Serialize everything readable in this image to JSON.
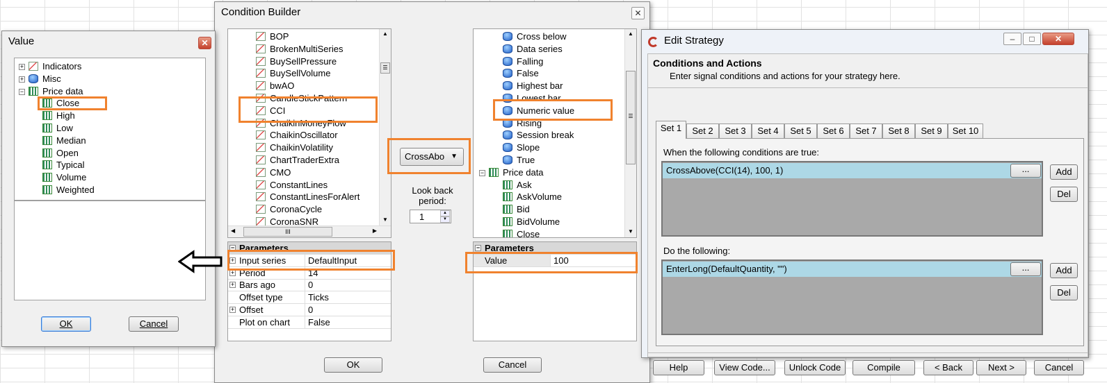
{
  "value_dialog": {
    "title": "Value",
    "tree": [
      {
        "label": "Indicators",
        "icon": "chart-icon",
        "exp": "+"
      },
      {
        "label": "Misc",
        "icon": "db-icon",
        "exp": "+"
      },
      {
        "label": "Price data",
        "icon": "bar-icon",
        "exp": "−"
      },
      {
        "label": "Close",
        "icon": "bar-icon"
      },
      {
        "label": "High",
        "icon": "bar-icon"
      },
      {
        "label": "Low",
        "icon": "bar-icon"
      },
      {
        "label": "Median",
        "icon": "bar-icon"
      },
      {
        "label": "Open",
        "icon": "bar-icon"
      },
      {
        "label": "Typical",
        "icon": "bar-icon"
      },
      {
        "label": "Volume",
        "icon": "bar-icon"
      },
      {
        "label": "Weighted",
        "icon": "bar-icon"
      }
    ],
    "ok": "OK",
    "cancel": "Cancel"
  },
  "condition_builder": {
    "title": "Condition Builder",
    "left_list": [
      "BOP",
      "BrokenMultiSeries",
      "BuySellPressure",
      "BuySellVolume",
      "bwAO",
      "CandleStickPattern",
      "CCI",
      "ChaikinMoneyFlow",
      "ChaikinOscillator",
      "ChaikinVolatility",
      "ChartTraderExtra",
      "CMO",
      "ConstantLines",
      "ConstantLinesForAlert",
      "CoronaCycle",
      "CoronaSNR"
    ],
    "hscroll_glyph": "III",
    "left_params_header": "Parameters",
    "left_params": [
      {
        "k": "Input series",
        "v": "DefaultInput",
        "exp": "+"
      },
      {
        "k": "Period",
        "v": "14",
        "exp": "+"
      },
      {
        "k": "Bars ago",
        "v": "0",
        "exp": "+"
      },
      {
        "k": "Offset type",
        "v": "Ticks",
        "exp": ""
      },
      {
        "k": "Offset",
        "v": "0",
        "exp": "+"
      },
      {
        "k": "Plot on chart",
        "v": "False",
        "exp": ""
      }
    ],
    "operator": "CrossAbo",
    "lookback_label": "Look back\nperiod:",
    "lookback_value": "1",
    "right_list": [
      {
        "label": "Cross below",
        "icon": "db-icon",
        "indent": 1
      },
      {
        "label": "Data series",
        "icon": "db-icon",
        "indent": 1
      },
      {
        "label": "Falling",
        "icon": "db-icon",
        "indent": 1
      },
      {
        "label": "False",
        "icon": "db-icon",
        "indent": 1
      },
      {
        "label": "Highest bar",
        "icon": "db-icon",
        "indent": 1
      },
      {
        "label": "Lowest bar",
        "icon": "db-icon",
        "indent": 1
      },
      {
        "label": "Numeric value",
        "icon": "db-icon",
        "indent": 1
      },
      {
        "label": "Rising",
        "icon": "db-icon",
        "indent": 1
      },
      {
        "label": "Session break",
        "icon": "db-icon",
        "indent": 1
      },
      {
        "label": "Slope",
        "icon": "db-icon",
        "indent": 1
      },
      {
        "label": "True",
        "icon": "db-icon",
        "indent": 1
      },
      {
        "label": "Price data",
        "icon": "bar-icon",
        "indent": 0,
        "exp": "−"
      },
      {
        "label": "Ask",
        "icon": "bar-icon",
        "indent": 1
      },
      {
        "label": "AskVolume",
        "icon": "bar-icon",
        "indent": 1
      },
      {
        "label": "Bid",
        "icon": "bar-icon",
        "indent": 1
      },
      {
        "label": "BidVolume",
        "icon": "bar-icon",
        "indent": 1
      },
      {
        "label": "Close",
        "icon": "bar-icon",
        "indent": 1
      }
    ],
    "right_params_header": "Parameters",
    "right_params": [
      {
        "k": "Value",
        "v": "100"
      }
    ],
    "ok": "OK",
    "cancel": "Cancel"
  },
  "edit_strategy": {
    "title": "Edit Strategy",
    "heading": "Conditions and Actions",
    "subheading": "Enter signal conditions and actions for your strategy here.",
    "tabs": [
      "Set 1",
      "Set 2",
      "Set 3",
      "Set 4",
      "Set 5",
      "Set 6",
      "Set 7",
      "Set 8",
      "Set 9",
      "Set 10"
    ],
    "conditions_label": "When the following conditions are true:",
    "condition": "CrossAbove(CCI(14), 100, 1)",
    "actions_label": "Do the following:",
    "action": "EnterLong(DefaultQuantity, \"\")",
    "ellipsis": "...",
    "add": "Add",
    "del": "Del",
    "footer": [
      "Help",
      "View Code...",
      "Unlock Code",
      "Compile",
      "< Back",
      "Next >",
      "Cancel"
    ]
  },
  "colors": {
    "highlight": "#f0822e",
    "selected_row": "#add8e6",
    "list_bg": "#a9a9a9"
  }
}
